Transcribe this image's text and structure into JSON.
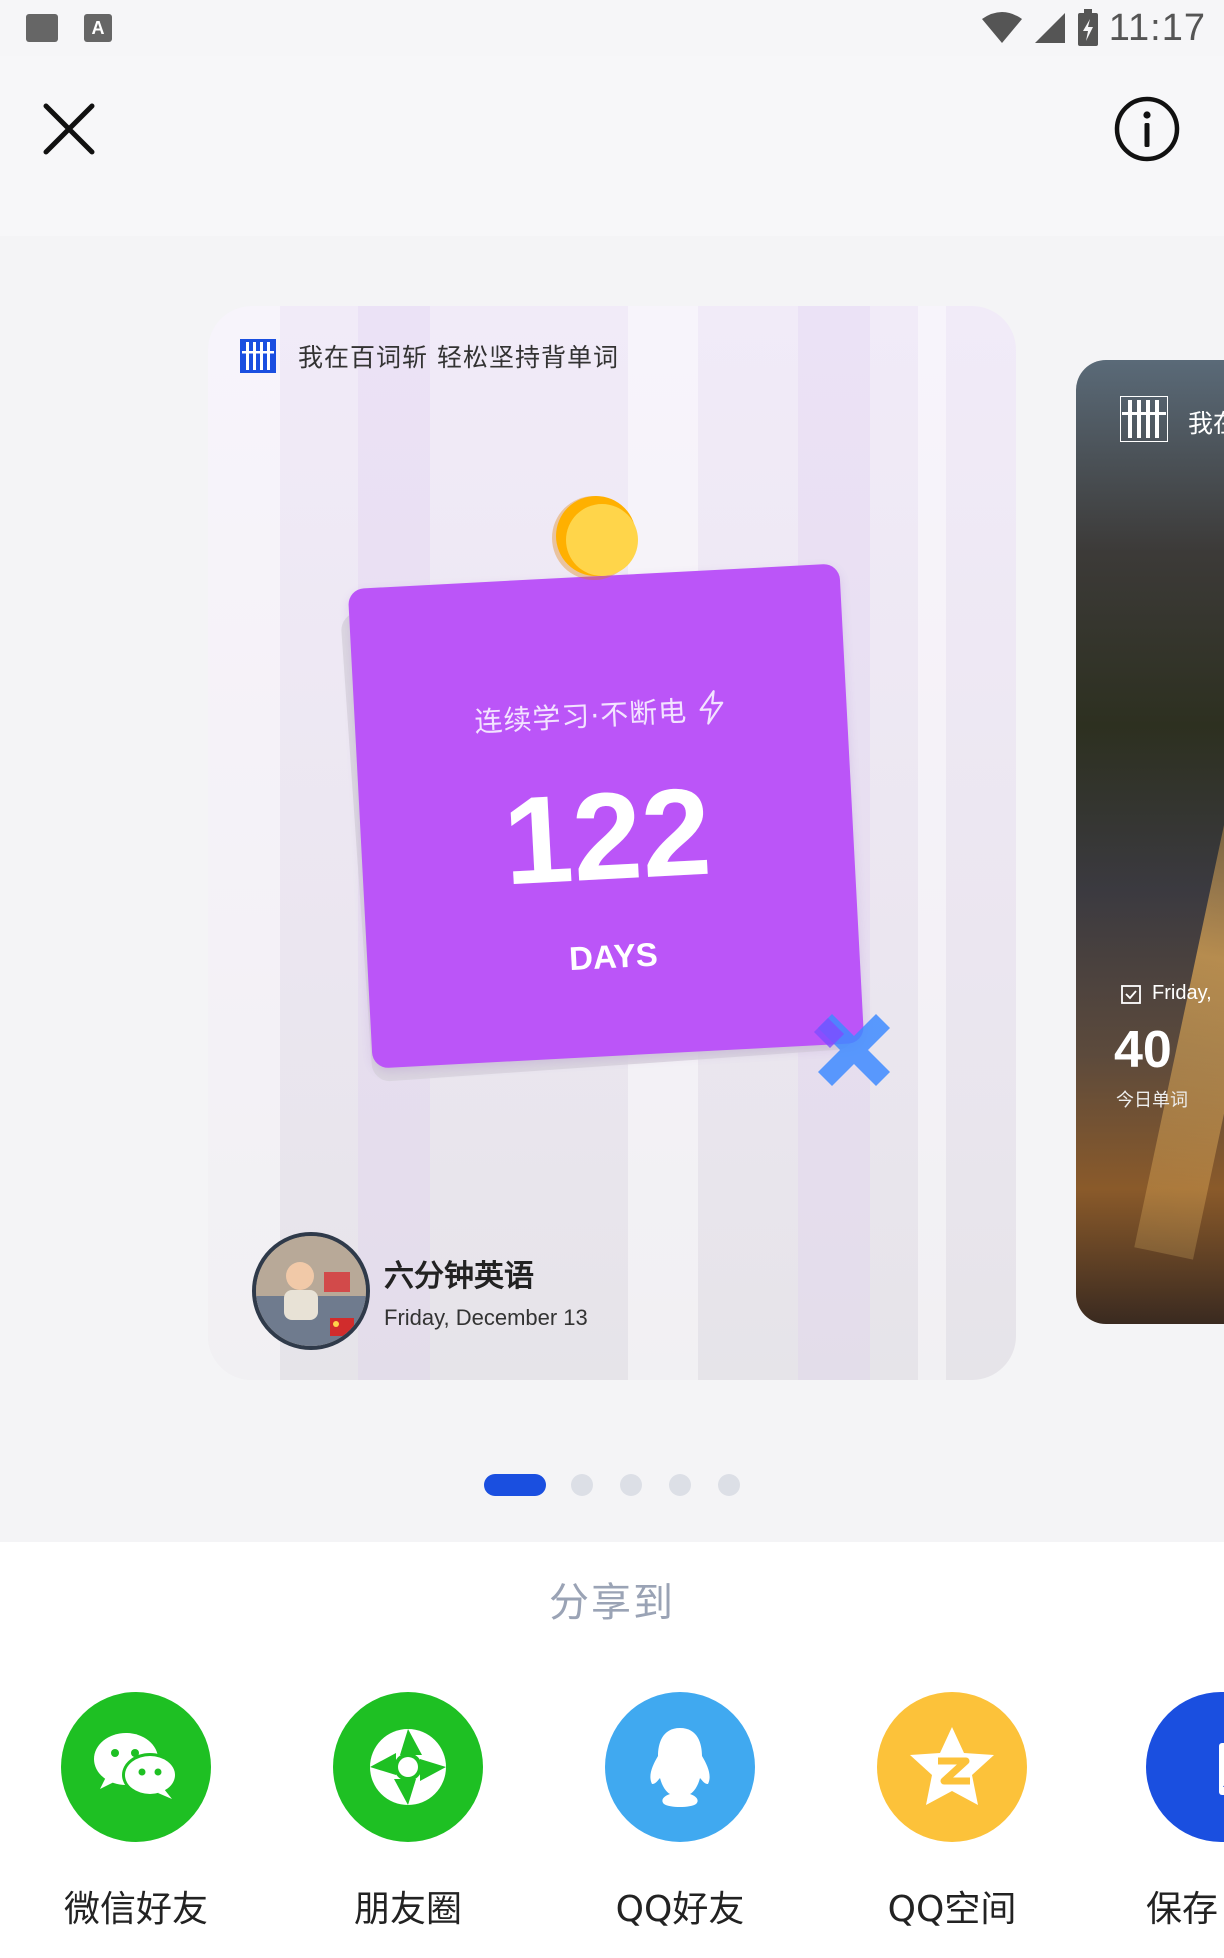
{
  "status_bar": {
    "time": "11:17",
    "icons": [
      "notification-square-icon",
      "app-a-icon",
      "wifi-icon",
      "cell-signal-icon",
      "battery-charging-icon"
    ]
  },
  "top_bar": {
    "close_icon": "close-icon",
    "info_icon": "info-icon"
  },
  "card": {
    "slogan": "我在百词斩 轻松坚持背单词",
    "subtitle": "连续学习·不断电",
    "days": "122",
    "unit": "DAYS",
    "user_name": "六分钟英语",
    "date": "Friday, December 13",
    "colors": {
      "note": "#bb55f8",
      "pin": "#ffc21a",
      "tape": "#3e8bff"
    }
  },
  "peek_card": {
    "title": "我在",
    "date": "Friday,",
    "count": "40",
    "count_label": "今日单词"
  },
  "pager": {
    "count": 5,
    "active": 0,
    "active_color": "#1a4fe0"
  },
  "share": {
    "title": "分享到",
    "targets": [
      {
        "label": "微信好友",
        "icon": "wechat-icon",
        "color": "#1ec023"
      },
      {
        "label": "朋友圈",
        "icon": "moments-icon",
        "color": "#1ec023"
      },
      {
        "label": "QQ好友",
        "icon": "qq-icon",
        "color": "#40a9f0"
      },
      {
        "label": "QQ空间",
        "icon": "qzone-icon",
        "color": "#fcc23a"
      },
      {
        "label": "保存",
        "icon": "save-image-icon",
        "color": "#1a4fe0"
      }
    ]
  }
}
